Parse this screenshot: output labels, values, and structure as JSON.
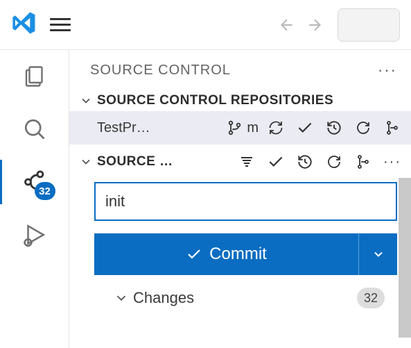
{
  "activitybar": {
    "scm_badge": "32"
  },
  "panel": {
    "title": "SOURCE CONTROL",
    "repositories_title": "SOURCE CONTROL REPOSITORIES",
    "repo_name": "TestPr…",
    "branch_label": "m",
    "source_control_title": "SOURCE …",
    "commit_input_value": "init",
    "commit_button": "Commit",
    "changes_label": "Changes",
    "changes_count": "32"
  }
}
